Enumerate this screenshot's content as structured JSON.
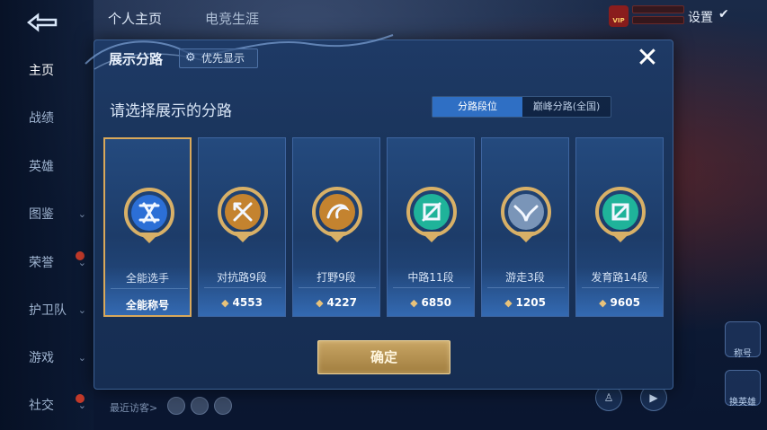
{
  "app": {
    "back_icon": "back-arrow-icon",
    "top_tabs": [
      "个人主页",
      "电竞生涯"
    ],
    "settings_label": "设置",
    "vip_label": "VIP"
  },
  "sidebar": {
    "items": [
      {
        "label": "主页",
        "active": true,
        "has_chevron": false,
        "has_dot": false
      },
      {
        "label": "战绩",
        "active": false,
        "has_chevron": false,
        "has_dot": false
      },
      {
        "label": "英雄",
        "active": false,
        "has_chevron": false,
        "has_dot": false
      },
      {
        "label": "图鉴",
        "active": false,
        "has_chevron": true,
        "has_dot": false
      },
      {
        "label": "荣誉",
        "active": false,
        "has_chevron": true,
        "has_dot": true
      },
      {
        "label": "护卫队",
        "active": false,
        "has_chevron": true,
        "has_dot": false
      },
      {
        "label": "游戏",
        "active": false,
        "has_chevron": true,
        "has_dot": false
      },
      {
        "label": "社交",
        "active": false,
        "has_chevron": true,
        "has_dot": true
      }
    ]
  },
  "bottom": {
    "visitor_label": "最近访客>"
  },
  "right_side": {
    "buttons": [
      "称号",
      "换英雄"
    ]
  },
  "modal": {
    "title": "展示分路",
    "priority_button": "优先显示",
    "close_icon": "close-icon",
    "prompt": "请选择展示的分路",
    "segments": [
      {
        "label": "分路段位",
        "active": true
      },
      {
        "label": "巅峰分路(全国)",
        "active": false
      }
    ],
    "cards": [
      {
        "name": "全能选手",
        "score": "全能称号",
        "has_points_icon": false,
        "selected": true,
        "emblem": "allround-emblem-icon",
        "emblem_color": "#2c6fd6"
      },
      {
        "name": "对抗路9段",
        "score": "4553",
        "has_points_icon": true,
        "selected": false,
        "emblem": "clash-lane-emblem-icon",
        "emblem_color": "#c4832f"
      },
      {
        "name": "打野9段",
        "score": "4227",
        "has_points_icon": true,
        "selected": false,
        "emblem": "jungle-emblem-icon",
        "emblem_color": "#c4832f"
      },
      {
        "name": "中路11段",
        "score": "6850",
        "has_points_icon": true,
        "selected": false,
        "emblem": "mid-lane-emblem-icon",
        "emblem_color": "#1fb39a"
      },
      {
        "name": "游走3段",
        "score": "1205",
        "has_points_icon": true,
        "selected": false,
        "emblem": "roam-emblem-icon",
        "emblem_color": "#7a95b8"
      },
      {
        "name": "发育路14段",
        "score": "9605",
        "has_points_icon": true,
        "selected": false,
        "emblem": "farm-lane-emblem-icon",
        "emblem_color": "#1fb39a"
      }
    ],
    "confirm_label": "确定"
  }
}
